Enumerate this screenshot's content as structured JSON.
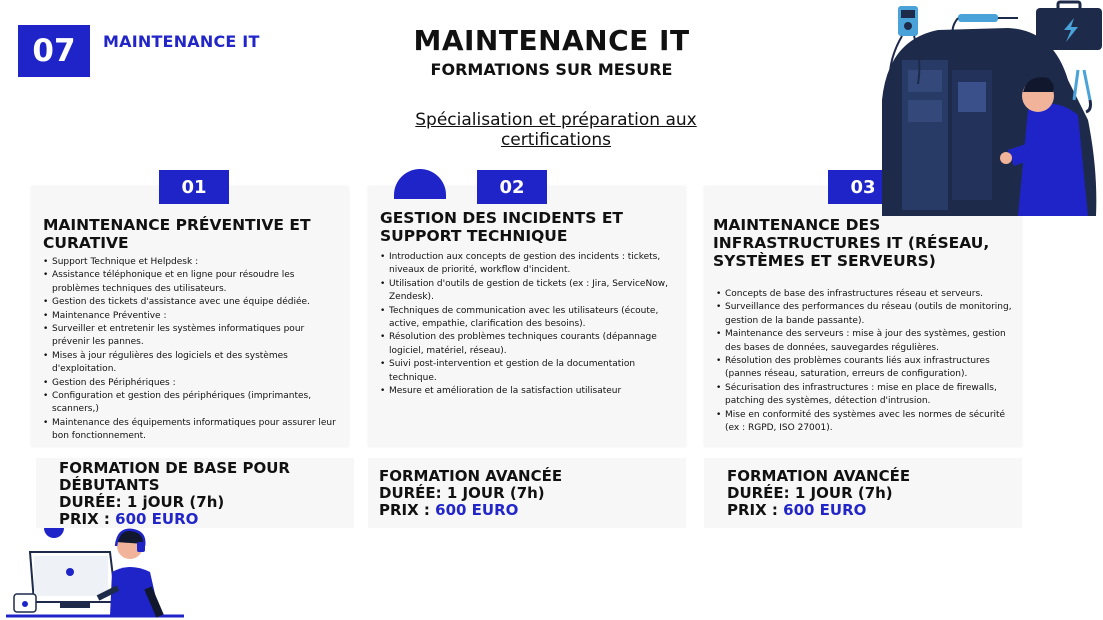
{
  "badge": "07",
  "section_label": "MAINTENANCE IT",
  "header": {
    "title": "MAINTENANCE IT",
    "subtitle": "FORMATIONS SUR MESURE",
    "link": "Spécialisation et préparation aux certifications"
  },
  "cards": [
    {
      "number": "01",
      "title": "MAINTENANCE PRÉVENTIVE ET CURATIVE",
      "items": [
        "Support Technique et Helpdesk :",
        "Assistance téléphonique et en ligne pour résoudre les problèmes techniques des utilisateurs.",
        "Gestion des tickets d'assistance avec une équipe dédiée.",
        "Maintenance Préventive :",
        "Surveiller et entretenir les systèmes informatiques pour prévenir les pannes.",
        "Mises à jour régulières des logiciels et des systèmes d'exploitation.",
        "Gestion des Périphériques :",
        "Configuration et gestion des périphériques (imprimantes, scanners,)",
        "Maintenance des équipements informatiques pour assurer leur bon fonctionnement."
      ],
      "level": "FORMATION DE BASE POUR DÉBUTANTS",
      "duration": "DURÉE: 1 jOUR (7h)",
      "price_label": "PRIX : ",
      "price_value": "600 EURO"
    },
    {
      "number": "02",
      "title": "GESTION DES INCIDENTS ET SUPPORT TECHNIQUE",
      "items": [
        "Introduction aux concepts de gestion des incidents : tickets, niveaux de priorité, workflow d'incident.",
        "Utilisation d'outils de gestion de tickets (ex : Jira, ServiceNow, Zendesk).",
        "Techniques de communication avec les utilisateurs (écoute, active, empathie, clarification des besoins).",
        "Résolution des problèmes techniques courants (dépannage logiciel, matériel, réseau).",
        "Suivi post-intervention et gestion de la documentation technique.",
        "Mesure et amélioration de la satisfaction utilisateur"
      ],
      "level": "FORMATION AVANCÉE",
      "duration": "DURÉE: 1 JOUR (7h)",
      "price_label": "PRIX : ",
      "price_value": "600 EURO"
    },
    {
      "number": "03",
      "title": "MAINTENANCE DES INFRASTRUCTURES IT (RÉSEAU, SYSTÈMES ET SERVEURS)",
      "items": [
        "Concepts de base des infrastructures réseau et serveurs.",
        "Surveillance des performances du réseau (outils de monitoring, gestion de la bande passante).",
        "Maintenance des serveurs : mise à jour des systèmes, gestion des bases de données, sauvegardes régulières.",
        "Résolution des problèmes courants liés aux infrastructures (pannes réseau, saturation, erreurs de configuration).",
        "Sécurisation des infrastructures : mise en place de firewalls, patching des systèmes, détection d'intrusion.",
        "Mise en conformité des systèmes avec les normes de sécurité (ex : RGPD, ISO 27001)."
      ],
      "level": "FORMATION AVANCÉE",
      "duration": "DURÉE: 1 JOUR (7h)",
      "price_label": "PRIX : ",
      "price_value": "600 EURO"
    }
  ],
  "colors": {
    "accent": "#1f24c9",
    "card_bg": "#f7f7f7"
  },
  "icons": [
    "technician-illustration",
    "multimeter-icon",
    "soldering-iron-icon",
    "toolbox-icon",
    "pliers-icon",
    "support-agent-illustration",
    "headset-icon"
  ]
}
